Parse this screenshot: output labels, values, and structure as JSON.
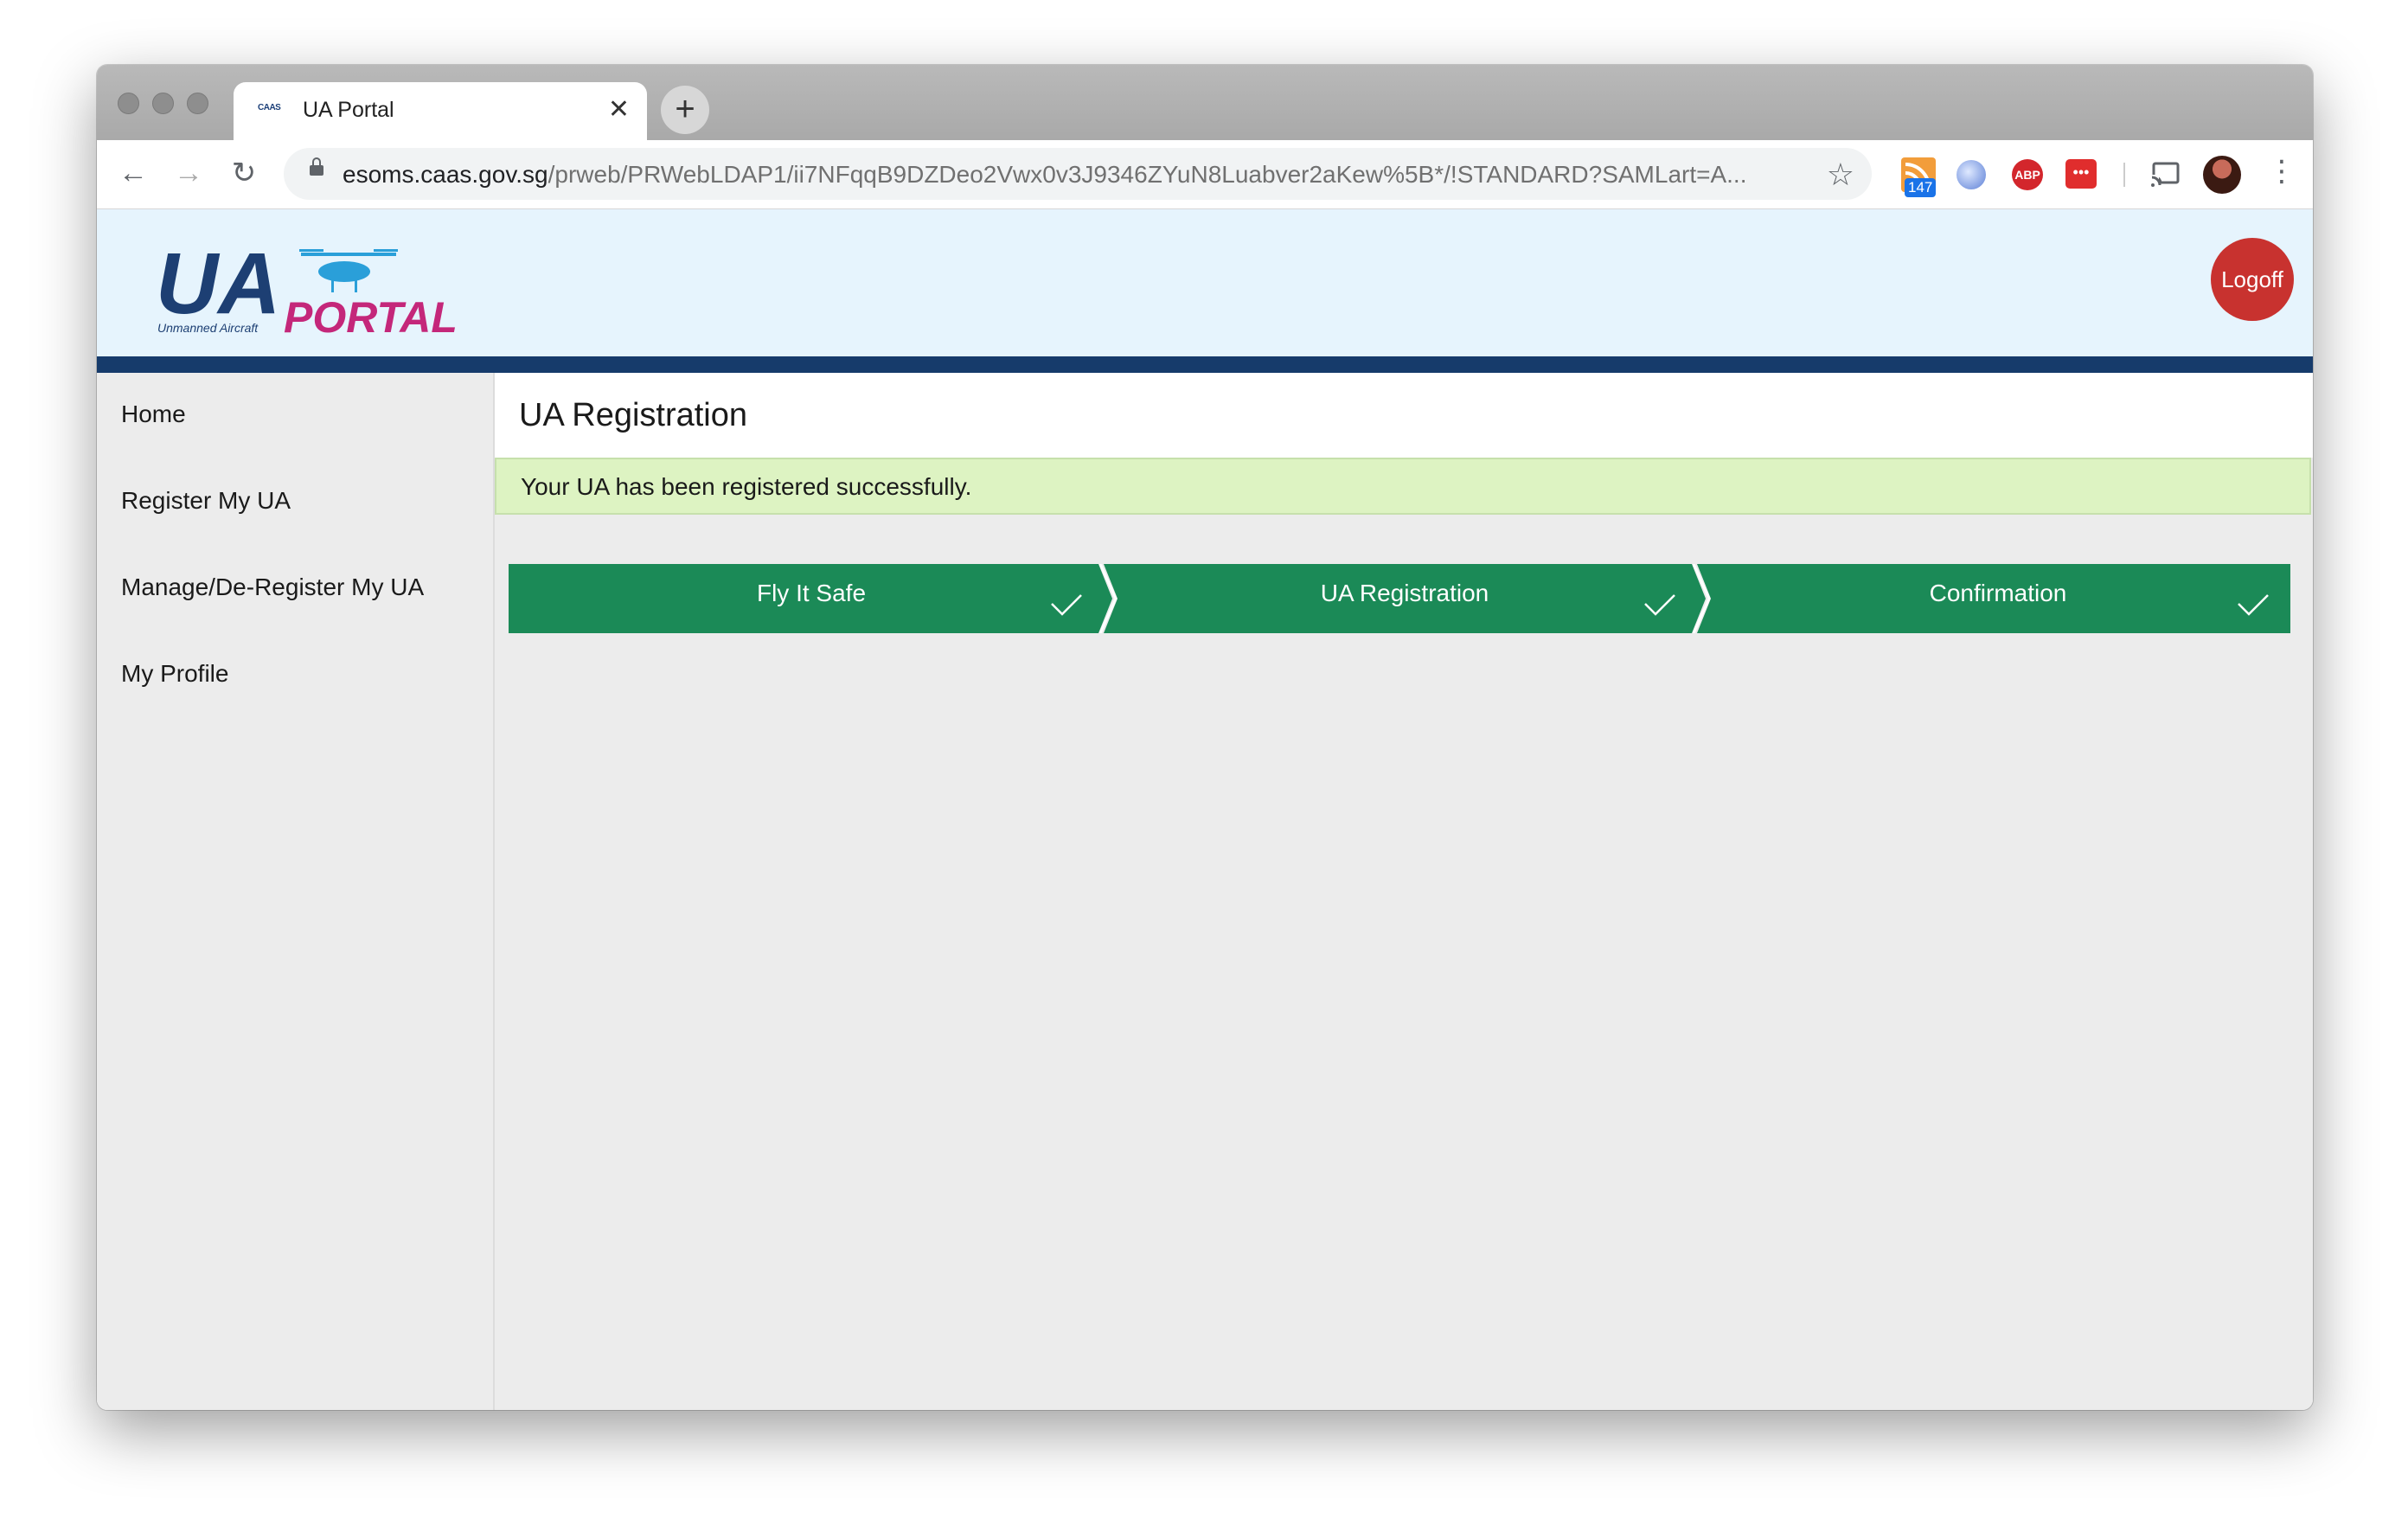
{
  "browser": {
    "tab_title": "UA Portal",
    "tab_favicon_text": "CAAS",
    "url_host": "esoms.caas.gov.sg",
    "url_path": "/prweb/PRWebLDAP1/ii7NFqqB9DZDeo2Vwx0v3J9346ZYuN8Luabver2aKew%5B*/!STANDARD?SAMLart=A...",
    "extension_badge": "147",
    "extension_abp": "ABP",
    "extension_red": "•••"
  },
  "header": {
    "logo_main": "UA",
    "logo_sub": "PORTAL",
    "logo_tagline": "Unmanned Aircraft",
    "logoff_label": "Logoff"
  },
  "sidebar": {
    "items": [
      {
        "label": "Home"
      },
      {
        "label": "Register My UA"
      },
      {
        "label": "Manage/De-Register My UA"
      },
      {
        "label": "My Profile"
      }
    ]
  },
  "main": {
    "title": "UA Registration",
    "success_message": "Your UA has been registered successfully.",
    "steps": [
      {
        "label": "Fly It Safe",
        "completed": true
      },
      {
        "label": "UA Registration",
        "completed": true
      },
      {
        "label": "Confirmation",
        "completed": true
      }
    ]
  },
  "colors": {
    "step_green": "#1b8a57",
    "header_bar": "#163b6b",
    "logoff_red": "#c8322f",
    "success_bg": "#ddf3c2"
  }
}
